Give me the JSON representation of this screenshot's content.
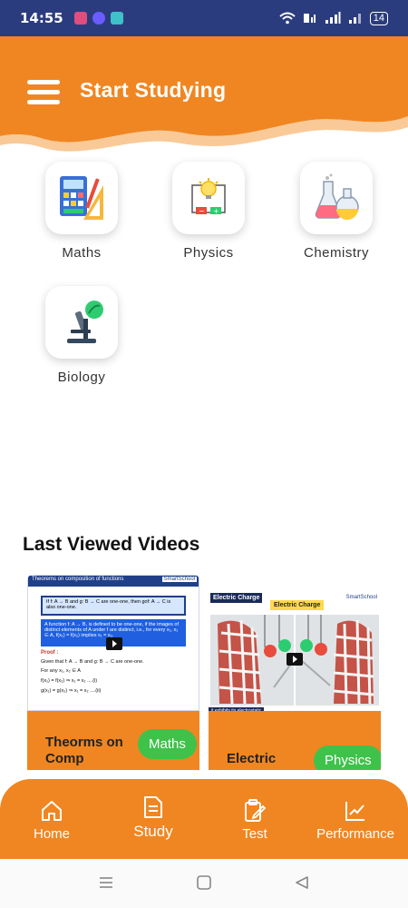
{
  "status": {
    "time": "14:55",
    "battery": "14"
  },
  "header": {
    "title": "Start Studying"
  },
  "subjects": [
    {
      "label": "Maths",
      "icon": "maths-icon"
    },
    {
      "label": "Physics",
      "icon": "physics-icon"
    },
    {
      "label": "Chemistry",
      "icon": "chemistry-icon"
    },
    {
      "label": "Biology",
      "icon": "biology-icon"
    }
  ],
  "section": {
    "last_viewed_title": "Last Viewed Videos"
  },
  "videos": [
    {
      "title": "Theorms on Comp",
      "subject": "Maths",
      "thumb": {
        "heading": "Theorems on composition of functions",
        "brand": "SmartSchool",
        "statement": "If f: A → B and g: B → C are one-one, then gof: A → C is also one-one.",
        "definition": "A function f: A → B, is defined to be one-one, if the images of distinct elements of A under f are distinct, i.e., for every x₁, x₂ ∈ A, f(x₁) = f(x₂) implies x₁ = x₂.",
        "proof_label": "Proof :",
        "proof_line1": "Given that f: A → B and g: B → C are one-one.",
        "proof_line2": "For any x₁, x₂ ∈ A",
        "proof_line3": "f(x₁) = f(x₂) ⇒ x₁ = x₂ ....(i)",
        "proof_line4": "g(x₁) = g(x₂) ⇒ x₁ = x₂ ....(ii)"
      }
    },
    {
      "title": "Electric",
      "subject": "Physics",
      "thumb": {
        "tag": "Electric Charge",
        "label": "Electric Charge",
        "brand": "SmartSchool",
        "footer": "it exhibits its electrostatic"
      }
    }
  ],
  "nav": [
    {
      "label": "Home",
      "icon": "home-icon"
    },
    {
      "label": "Study",
      "icon": "study-icon"
    },
    {
      "label": "Test",
      "icon": "test-icon"
    },
    {
      "label": "Performance",
      "icon": "performance-icon"
    }
  ],
  "colors": {
    "accent": "#f08622",
    "status_bar": "#2b3c7e",
    "pill": "#3ec24a"
  }
}
